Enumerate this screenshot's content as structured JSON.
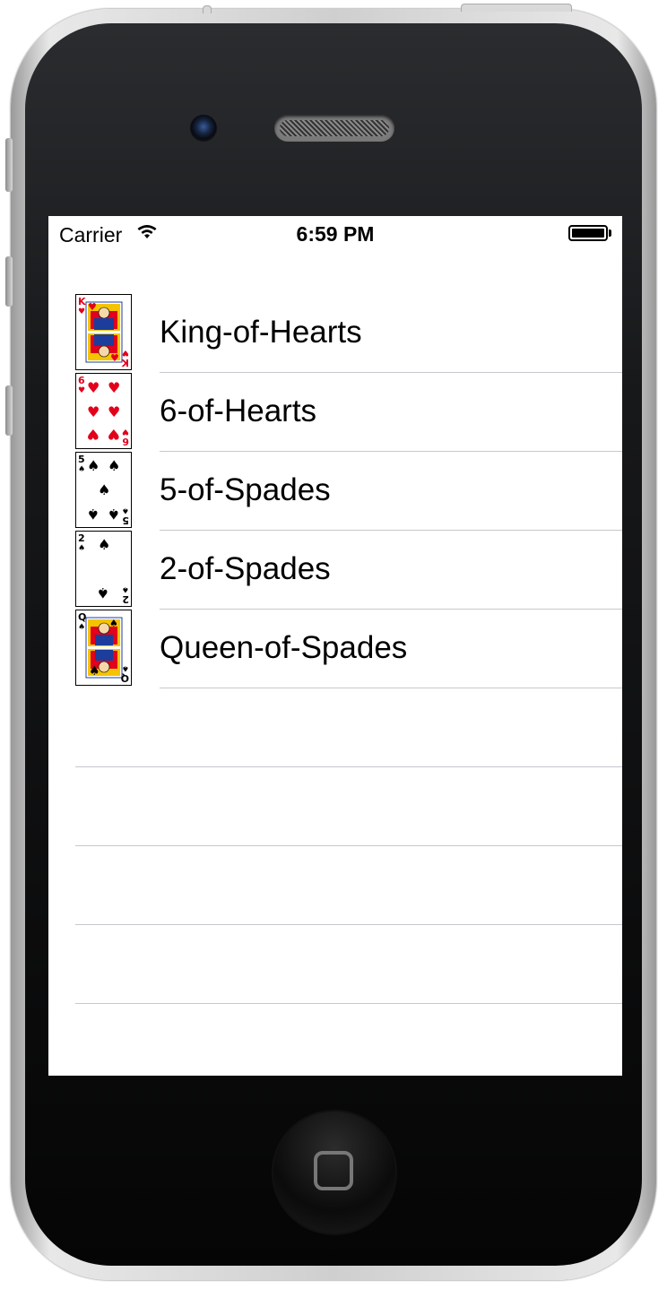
{
  "status_bar": {
    "carrier": "Carrier",
    "time": "6:59 PM"
  },
  "rows": [
    {
      "label": "King-of-Hearts",
      "card_icon": "king-of-hearts-card-icon",
      "suit_color": "#e2001a"
    },
    {
      "label": "6-of-Hearts",
      "card_icon": "six-of-hearts-card-icon",
      "suit_color": "#e2001a"
    },
    {
      "label": "5-of-Spades",
      "card_icon": "five-of-spades-card-icon",
      "suit_color": "#000000"
    },
    {
      "label": "2-of-Spades",
      "card_icon": "two-of-spades-card-icon",
      "suit_color": "#000000"
    },
    {
      "label": "Queen-of-Spades",
      "card_icon": "queen-of-spades-card-icon",
      "suit_color": "#000000"
    }
  ],
  "colors": {
    "separator": "#c8c7cc",
    "red_suit": "#e2001a",
    "black_suit": "#000000"
  }
}
